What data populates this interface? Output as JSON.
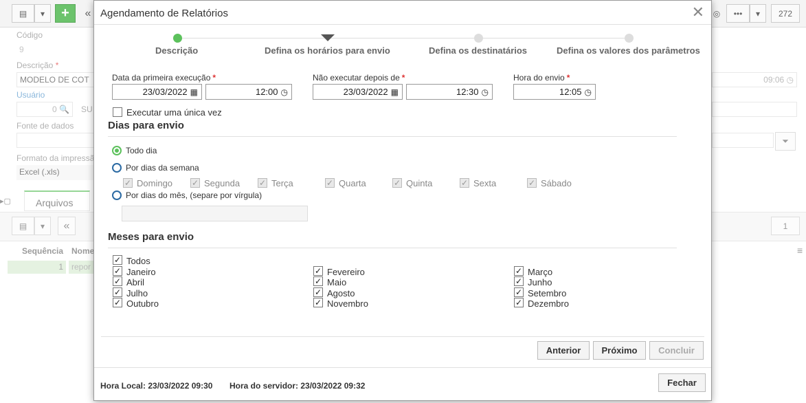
{
  "background": {
    "toolbar_count": "272",
    "fields": {
      "codigo_label": "Código",
      "codigo_value": "9",
      "descricao_label": "Descrição",
      "descricao_value": "MODELO DE COT",
      "usuario_label": "Usuário",
      "usuario_value": "0",
      "usuario_code": "SU",
      "fonte_label": "Fonte de dados",
      "formato_label": "Formato da impressão",
      "formato_value": "Excel (.xls)",
      "time_value": "09:06"
    },
    "tab_arquivos": "Arquivos",
    "grid": {
      "page": "1",
      "col_sequencia": "Sequência",
      "col_nome": "Nome",
      "row_seq": "1",
      "row_nome": "repor"
    }
  },
  "modal": {
    "title": "Agendamento de Relatórios",
    "steps": [
      {
        "label": "Descrição",
        "state": "done"
      },
      {
        "label": "Defina os horários para envio",
        "state": "current"
      },
      {
        "label": "Defina os destinatários",
        "state": "pending"
      },
      {
        "label": "Defina os valores dos parâmetros",
        "state": "pending"
      }
    ],
    "first_exec": {
      "label": "Data da primeira execução",
      "date": "23/03/2022",
      "time": "12:00"
    },
    "not_after": {
      "label": "Não executar depois de",
      "date": "23/03/2022",
      "time": "12:30"
    },
    "send_hour": {
      "label": "Hora do envio",
      "time": "12:05"
    },
    "once_label": "Executar uma única vez",
    "days_title": "Dias para envio",
    "day_options": {
      "todo_dia": "Todo dia",
      "semana": "Por dias da semana",
      "mes": "Por dias do mês, (separe por vírgula)"
    },
    "weekdays": [
      "Domingo",
      "Segunda",
      "Terça",
      "Quarta",
      "Quinta",
      "Sexta",
      "Sábado"
    ],
    "months_title": "Meses para envio",
    "todos": "Todos",
    "months": [
      "Janeiro",
      "Fevereiro",
      "Março",
      "Abril",
      "Maio",
      "Junho",
      "Julho",
      "Agosto",
      "Setembro",
      "Outubro",
      "Novembro",
      "Dezembro"
    ],
    "buttons": {
      "anterior": "Anterior",
      "proximo": "Próximo",
      "concluir": "Concluir",
      "fechar": "Fechar"
    },
    "hora_local": "Hora Local: 23/03/2022 09:30",
    "hora_servidor": "Hora do servidor: 23/03/2022 09:32"
  },
  "colors": {
    "accent_green": "#5cc15c",
    "radio_blue": "#2b6aa3",
    "required": "#d33333"
  }
}
